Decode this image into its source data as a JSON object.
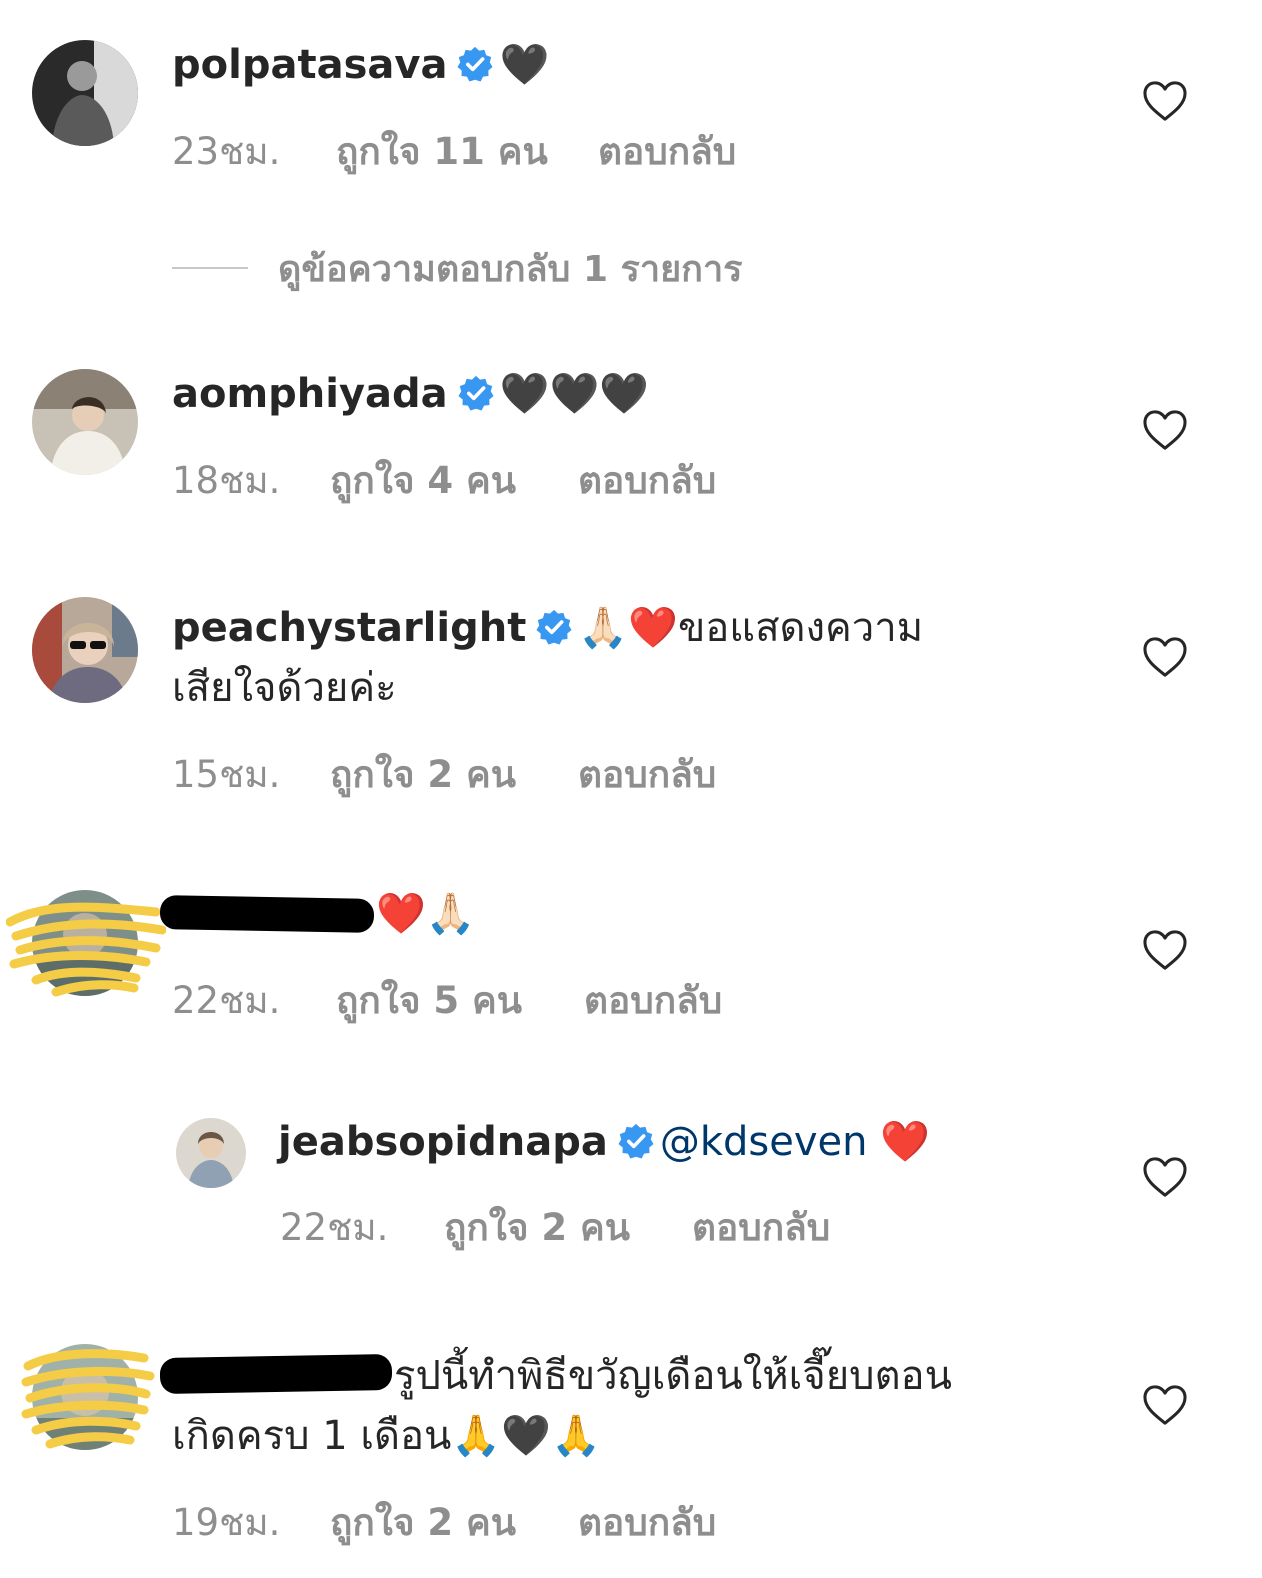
{
  "view_replies_label": "ดูข้อความตอบกลับ 1 รายการ",
  "comments": [
    {
      "username": "polpatasava",
      "verified": true,
      "text": "🖤",
      "time": "23ชม.",
      "likes": "ถูกใจ 11 คน",
      "reply": "ตอบกลับ"
    },
    {
      "username": "aomphiyada",
      "verified": true,
      "text": "🖤🖤🖤",
      "time": "18ชม.",
      "likes": "ถูกใจ 4 คน",
      "reply": "ตอบกลับ"
    },
    {
      "username": "peachystarlight",
      "verified": true,
      "text_line1": "🙏🏻❤️ขอแสดงความ",
      "text_line2": "เสียใจด้วยค่ะ",
      "time": "15ชม.",
      "likes": "ถูกใจ 2 คน",
      "reply": "ตอบกลับ"
    },
    {
      "username": "",
      "redacted": true,
      "text": "❤️🙏🏻",
      "time": "22ชม.",
      "likes": "ถูกใจ 5 คน",
      "reply": "ตอบกลับ"
    },
    {
      "username": "jeabsopidnapa",
      "verified": true,
      "mention": "@kdseven",
      "text": "❤️",
      "time": "22ชม.",
      "likes": "ถูกใจ 2 คน",
      "reply": "ตอบกลับ"
    },
    {
      "username": "",
      "redacted": true,
      "text_line1": "รูปนี้ทำพิธีขวัญเดือนให้เจี๊ยบตอน",
      "text_line2": "เกิดครบ 1 เดือน🙏🖤🙏",
      "time": "19ชม.",
      "likes": "ถูกใจ 2 คน",
      "reply": "ตอบกลับ"
    }
  ],
  "icons": {
    "verified": "verified-badge-icon",
    "like": "heart-outline-icon"
  },
  "colors": {
    "primary_text": "#262626",
    "secondary_text": "#8e8e8e",
    "verified_blue": "#3897f0",
    "mention": "#00376b"
  }
}
